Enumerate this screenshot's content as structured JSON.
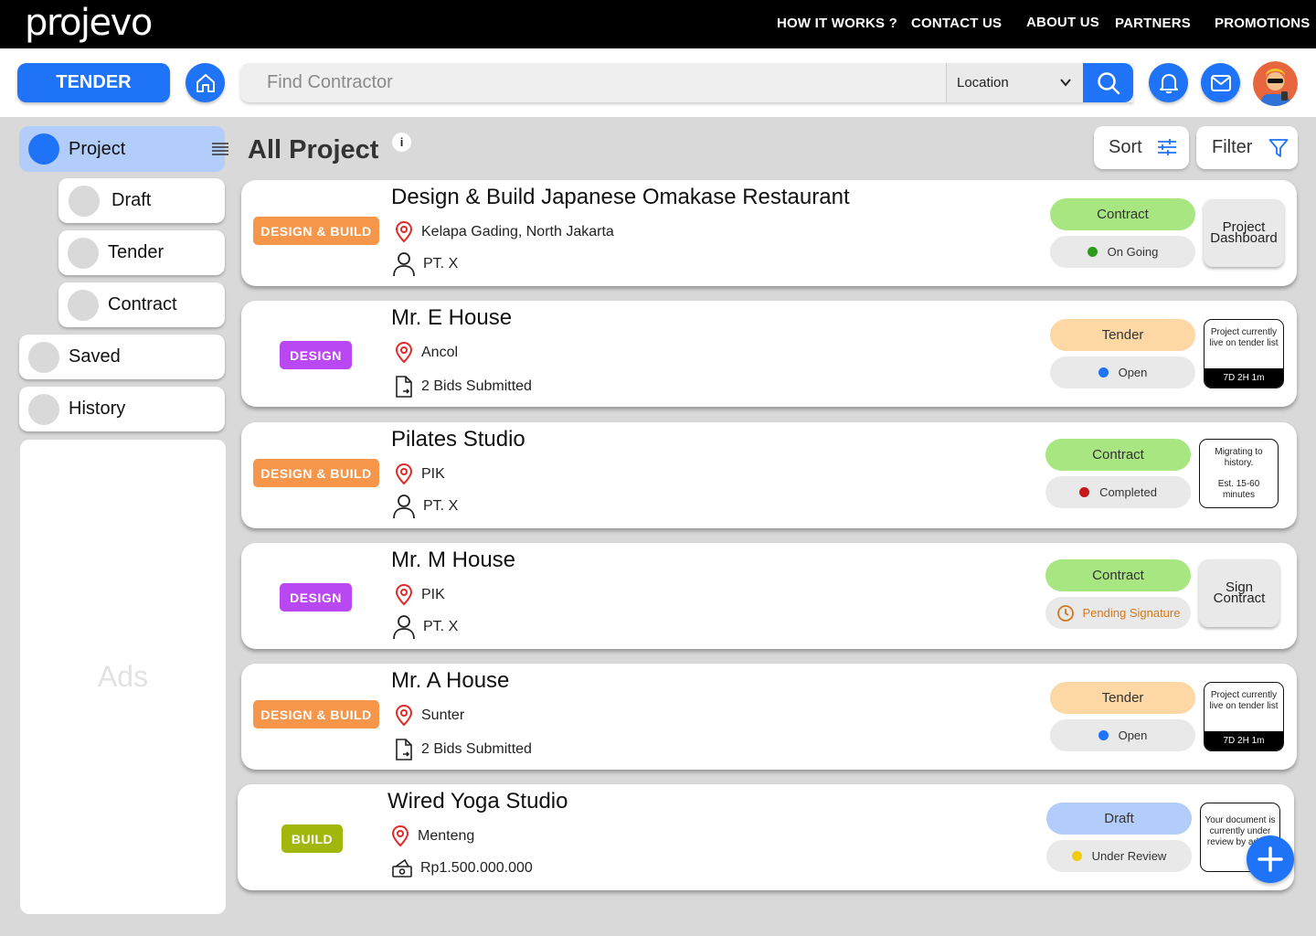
{
  "brand": "projevo",
  "nav": {
    "how_it_works": "HOW IT WORKS ?",
    "contact": "CONTACT US",
    "about": "ABOUT US",
    "partners": "PARTNERS",
    "promotions": "PROMOTIONS"
  },
  "header": {
    "tender_button": "TENDER",
    "search_placeholder": "Find Contractor",
    "location_label": "Location",
    "icons": [
      "home-icon",
      "search-icon",
      "bell-icon",
      "mail-icon"
    ]
  },
  "sidebar": {
    "project": "Project",
    "sub_items": [
      "Draft",
      "Tender",
      "Contract"
    ],
    "saved": "Saved",
    "history": "History",
    "ads": "Ads"
  },
  "main": {
    "title": "All Project",
    "info": "i",
    "sort": "Sort",
    "filter": "Filter"
  },
  "projects": [
    {
      "tag": "DESIGN & BUILD",
      "title": "Design & Build Japanese Omakase Restaurant",
      "location": "Kelapa Gading, North Jakarta",
      "detail": "PT. X",
      "detail_icon": "person-icon",
      "stage": "Contract",
      "status": "On Going",
      "status_color": "#2e9a1d",
      "action": "Project Dashboard"
    },
    {
      "tag": "DESIGN",
      "title": "Mr. E House",
      "location": "Ancol",
      "detail": "2 Bids Submitted",
      "detail_icon": "document-icon",
      "stage": "Tender",
      "status": "Open",
      "status_color": "#1f73f6",
      "note": "Project currently live on tender list",
      "timer": "7D 2H 1m"
    },
    {
      "tag": "DESIGN & BUILD",
      "title": "Pilates Studio",
      "location": "PIK",
      "detail": "PT. X",
      "detail_icon": "person-icon",
      "stage": "Contract",
      "status": "Completed",
      "status_color": "#c81717",
      "note": "Migrating to history.",
      "note2": "Est. 15-60 minutes"
    },
    {
      "tag": "DESIGN",
      "title": "Mr. M House",
      "location": "PIK",
      "detail": "PT. X",
      "detail_icon": "person-icon",
      "stage": "Contract",
      "status": "Pending Signature",
      "status_color": "#d2781c",
      "action": "Sign Contract"
    },
    {
      "tag": "DESIGN & BUILD",
      "title": "Mr. A House",
      "location": "Sunter",
      "detail": "2 Bids Submitted",
      "detail_icon": "document-icon",
      "stage": "Tender",
      "status": "Open",
      "status_color": "#1f73f6",
      "note": "Project currently live on tender list",
      "timer": "7D 2H 1m"
    },
    {
      "tag": "BUILD",
      "title": "Wired Yoga Studio",
      "location": "Menteng",
      "detail": "Rp1.500.000.000",
      "detail_icon": "money-icon",
      "stage": "Draft",
      "status": "Under Review",
      "status_color": "#f0cb10",
      "note": "Your document is currently under review by admin"
    }
  ],
  "colors": {
    "accent": "#1f73f6",
    "design_build_tag": "#f5964b",
    "design_tag": "#b948f2",
    "build_tag": "#a2b70c",
    "contract_pill": "#a8e681",
    "tender_pill": "#fdd8a5",
    "draft_pill": "#b3cdfb"
  }
}
